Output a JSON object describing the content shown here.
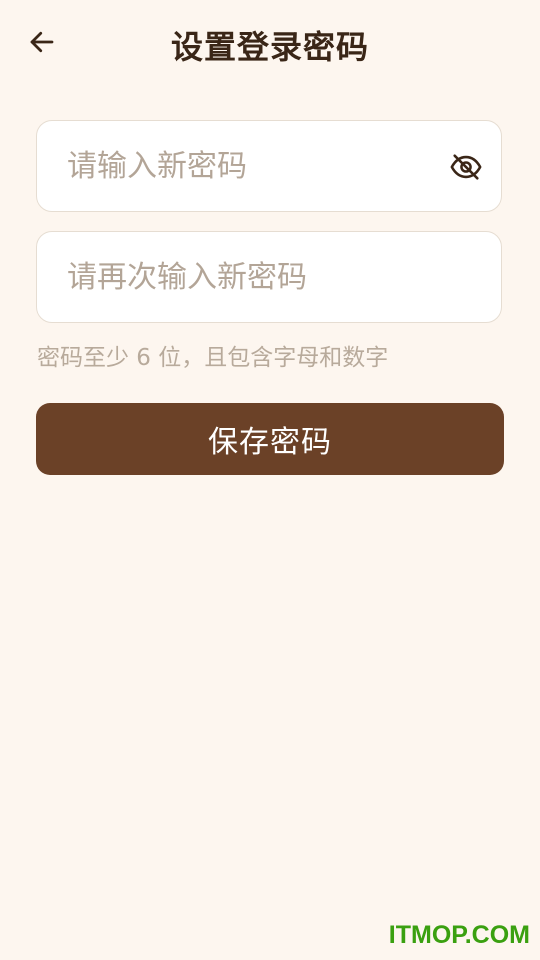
{
  "header": {
    "back_icon": "arrow-left-icon",
    "title": "设置登录密码"
  },
  "form": {
    "new_password": {
      "value": "",
      "placeholder": "请输入新密码",
      "toggle_icon": "eye-slash-icon"
    },
    "confirm_password": {
      "value": "",
      "placeholder": "请再次输入新密码"
    },
    "hint": "密码至少 6 位，且包含字母和数字",
    "save_label": "保存密码"
  },
  "watermark": "ITMOP.COM",
  "colors": {
    "background": "#fdf6ef",
    "primary_button": "#6b4127",
    "title": "#3a2617",
    "placeholder": "#b3a597",
    "watermark": "#3aa010"
  }
}
